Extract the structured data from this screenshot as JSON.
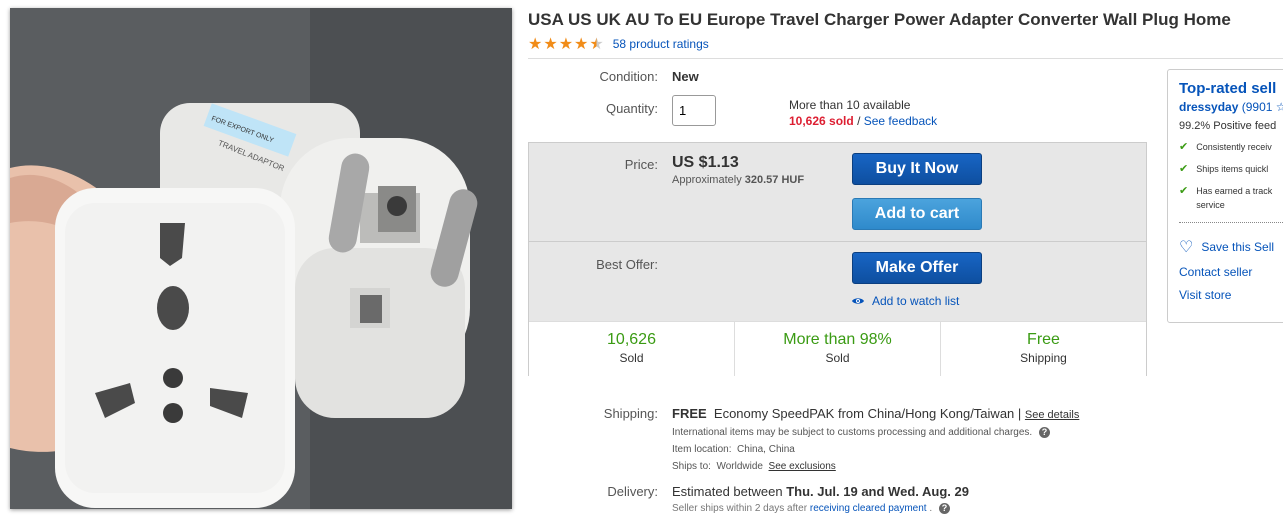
{
  "product": {
    "title": "USA US UK AU To EU Europe Travel Charger Power Adapter Converter Wall Plug Home",
    "rating_value": 4.5,
    "ratings_link": "58 product ratings",
    "photo_label_1": "FOR EXPORT ONLY",
    "photo_label_2": "TRAVEL ADAPTOR"
  },
  "condition": {
    "label": "Condition:",
    "value": "New"
  },
  "quantity": {
    "label": "Quantity:",
    "value": "1",
    "available": "More than 10 available",
    "sold": "10,626 sold",
    "separator": "/",
    "feedback_link": "See feedback"
  },
  "price": {
    "label": "Price:",
    "value": "US $1.13",
    "approx_prefix": "Approximately",
    "approx_value": "320.57 HUF",
    "buy_button": "Buy It Now",
    "cart_button": "Add to cart"
  },
  "offer": {
    "label": "Best Offer:",
    "make_offer_button": "Make Offer",
    "watch_link": "Add to watch list"
  },
  "stats": [
    {
      "big": "10,626",
      "small": "Sold"
    },
    {
      "big": "More than 98%",
      "small": "Sold"
    },
    {
      "big": "Free",
      "small": "Shipping"
    }
  ],
  "shipping": {
    "label": "Shipping:",
    "free": "FREE",
    "method": "Economy SpeedPAK from China/Hong Kong/Taiwan |",
    "details_link": "See details",
    "customs_note": "International items may be subject to customs processing and additional charges.",
    "location_label": "Item location:",
    "location_value": "China, China",
    "ships_to_label": "Ships to:",
    "ships_to_value": "Worldwide",
    "exclusions_link": "See exclusions"
  },
  "delivery": {
    "label": "Delivery:",
    "prefix": "Estimated between",
    "range": "Thu. Jul. 19 and Wed. Aug. 29",
    "note_prefix": "Seller ships within 2 days after",
    "note_link": "receiving cleared payment",
    "note_suffix": "."
  },
  "seller": {
    "heading": "Top-rated sell",
    "name": "dressyday",
    "score": "(9901 ☆",
    "positive": "99.2% Positive feed",
    "features": [
      "Consistently receiv",
      "Ships items quickl",
      "Has earned a track"
    ],
    "feature_cont": "service",
    "save_link": "Save this Sell",
    "contact_link": "Contact seller",
    "visit_link": "Visit store"
  },
  "colors": {
    "link": "#0654ba",
    "star": "#f18c18",
    "sold_red": "#dd1e31",
    "stat_green": "#3a9b13",
    "primary_button": "#1865c4",
    "cart_button": "#4ba3dd"
  }
}
